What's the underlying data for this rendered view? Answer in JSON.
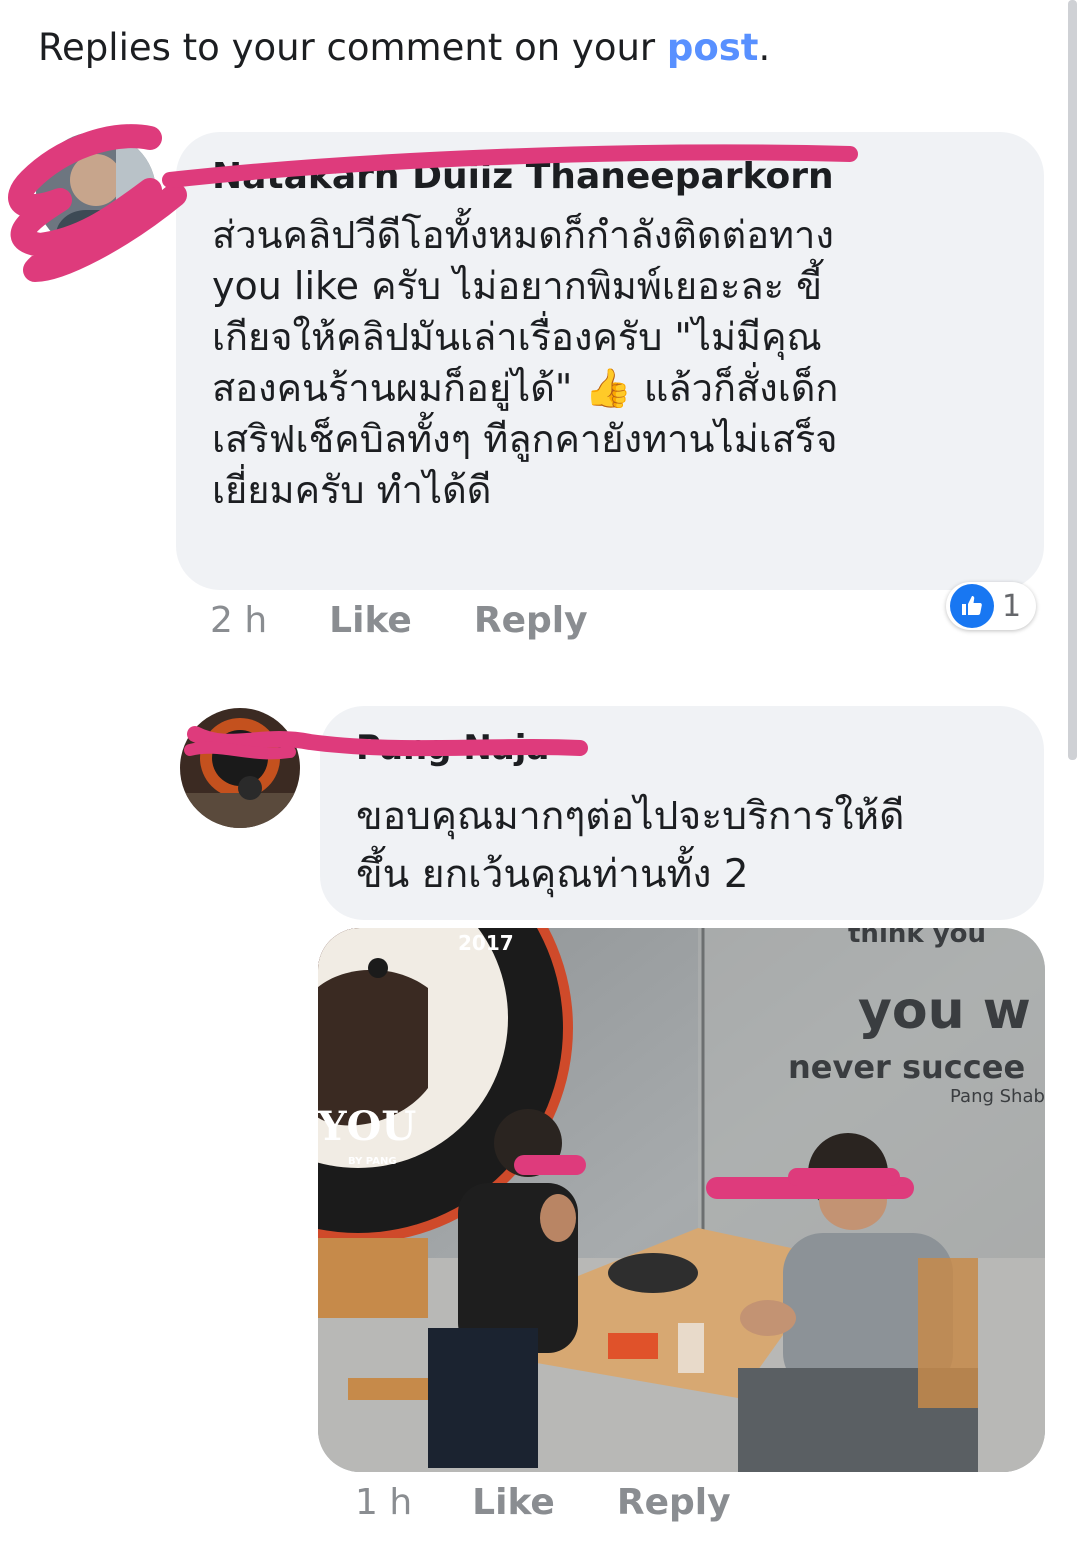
{
  "header": {
    "text_before": "Replies to your comment on your ",
    "link": "post",
    "text_after": "."
  },
  "comments": [
    {
      "author": "Natakarn Duiiz Thaneeparkorn",
      "lines": [
        "ส่วนคลิปวีดีโอทั้งหมดก็กำลังติดต่อทาง",
        "you like  ครับ ไม่อยากพิมพ์เยอะละ ขี้",
        "เกียจให้คลิปมันเล่าเรื่องครับ \"ไม่มีคุณ",
        "สองคนร้านผมก็อยู่ได้\" 👍 แล้วก็สั่งเด็ก",
        "เสริฟเช็คบิลทั้งๆ ทีลูกคายังทานไม่เสร็จ",
        "เยี่ยมครับ ทำได้ดี"
      ],
      "time": "2 h",
      "like_label": "Like",
      "reply_label": "Reply",
      "reaction_count": "1"
    },
    {
      "author": "Pang Naja",
      "lines": [
        "ขอบคุณมากๆต่อไปจะบริการให้ดี",
        "ขึ้น ยกเว้นคุณท่านทั้ง 2"
      ],
      "time": "1 h",
      "like_label": "Like",
      "reply_label": "Reply"
    }
  ],
  "photo": {
    "sign_year": "2017",
    "sign_word": "YOU",
    "sign_small": "BY PANG",
    "wall_text_1": "think you",
    "wall_text_2": "you w",
    "wall_text_3": "never succee",
    "wall_text_4": "Pang Shab"
  },
  "colors": {
    "link": "#5890ff",
    "bubble": "#f0f2f5",
    "redaction": "#de3b7c",
    "like_blue": "#1877f2"
  }
}
